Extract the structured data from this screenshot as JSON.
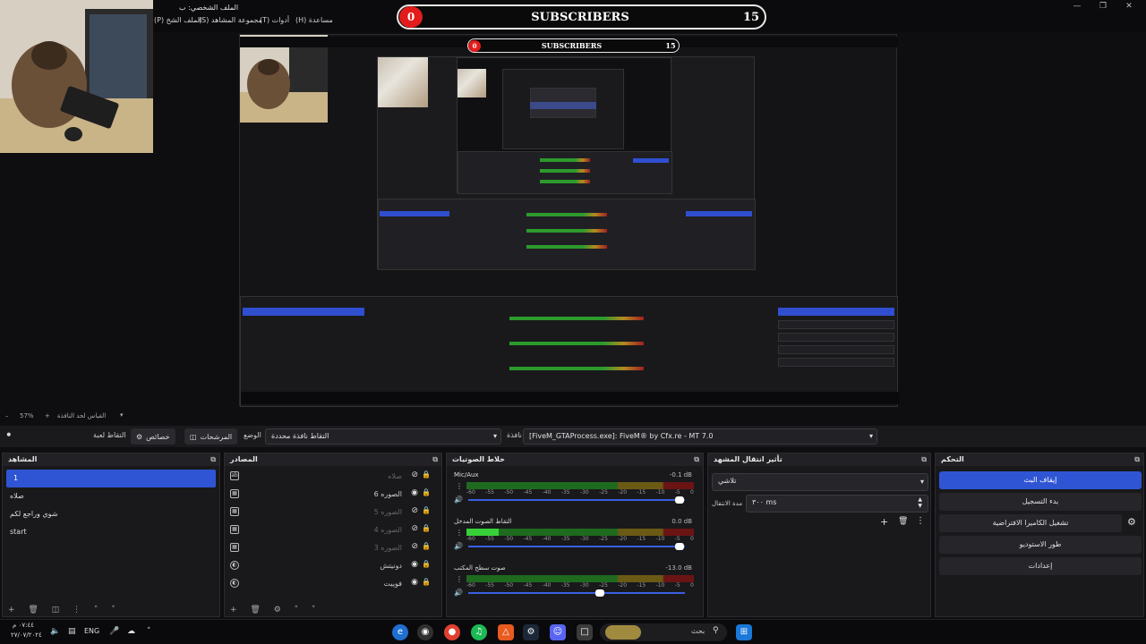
{
  "window": {
    "title": "الملف الشخصي: ب",
    "title_fragment": "الملف الشخ",
    "menu": [
      "(P) الملف الشخ",
      "(S) مجموعة المشاهد",
      "(T) أدوات",
      "(H) مساعدة"
    ]
  },
  "banner": {
    "label": "SUBSCRIBERS",
    "left_count": "0",
    "right_count": "15"
  },
  "preview_banner": {
    "label": "SUBSCRIBERS",
    "left_count": "0",
    "right_count": "15"
  },
  "status": {
    "zoom": "57%",
    "fit_label": "القياس لحد النافذة"
  },
  "context_bar": {
    "capture_label": "التقاط لعبة",
    "properties_label": "خصائص",
    "filters_label": "المرشحات",
    "mode_label": "الوضع",
    "mode_value": "التقاط نافذة محددة",
    "window_label": "نافذة",
    "window_value": "[FiveM_GTAProcess.exe]: FiveM® by Cfx.re - MT 7.0"
  },
  "docks": {
    "scenes": {
      "title": "المشاهد",
      "items": [
        {
          "label": "1",
          "selected": true
        },
        {
          "label": "صلاه",
          "selected": false
        },
        {
          "label": "شوي وراجع لكم",
          "selected": false
        },
        {
          "label": "start",
          "selected": false
        }
      ]
    },
    "sources": {
      "title": "المصادر",
      "items": [
        {
          "name": "صلاه",
          "icon": "text-icon",
          "dim": true
        },
        {
          "name": "الصوره 6",
          "icon": "image-icon",
          "dim": false
        },
        {
          "name": "الصوره 5",
          "icon": "image-icon",
          "dim": true
        },
        {
          "name": "الصوره 4",
          "icon": "image-icon",
          "dim": true
        },
        {
          "name": "الصوره 3",
          "icon": "image-icon",
          "dim": true
        },
        {
          "name": "دونيتش",
          "icon": "browser-icon",
          "dim": false
        },
        {
          "name": "فوييت",
          "icon": "browser-icon",
          "dim": false
        }
      ]
    },
    "mixer": {
      "title": "خلاط الصوتيات",
      "scale": [
        "-60",
        "-55",
        "-50",
        "-45",
        "-40",
        "-35",
        "-30",
        "-25",
        "-20",
        "-15",
        "-10",
        "-5",
        "0"
      ],
      "channels": [
        {
          "name": "Mic/Aux",
          "db": "-0.1 dB",
          "level": 0,
          "fader": 0.98
        },
        {
          "name": "التقاط الصوت المدخل",
          "db": "0.0 dB",
          "level": 0.14,
          "fader": 0.98
        },
        {
          "name": "صوت سطح المكتب",
          "db": "-13.0 dB",
          "level": 0,
          "fader": 0.6
        }
      ]
    },
    "transitions": {
      "title": "تأثير انتقال المشهد",
      "type": "تلاشي",
      "duration_label": "مدة الانتقال",
      "duration_value": "٣٠٠ ms"
    },
    "controls": {
      "title": "التحكم",
      "buttons": [
        "إيقاف البث",
        "بدء التسجيل",
        "تشغيل الكاميرا الافتراضية",
        "طور الاستوديو",
        "إعدادات"
      ]
    }
  },
  "taskbar": {
    "search_placeholder": "بحث",
    "language": "ENG",
    "time": "٠٧:٤٤ م",
    "date": "٢٧/٠٧/٢٠٢٤"
  }
}
